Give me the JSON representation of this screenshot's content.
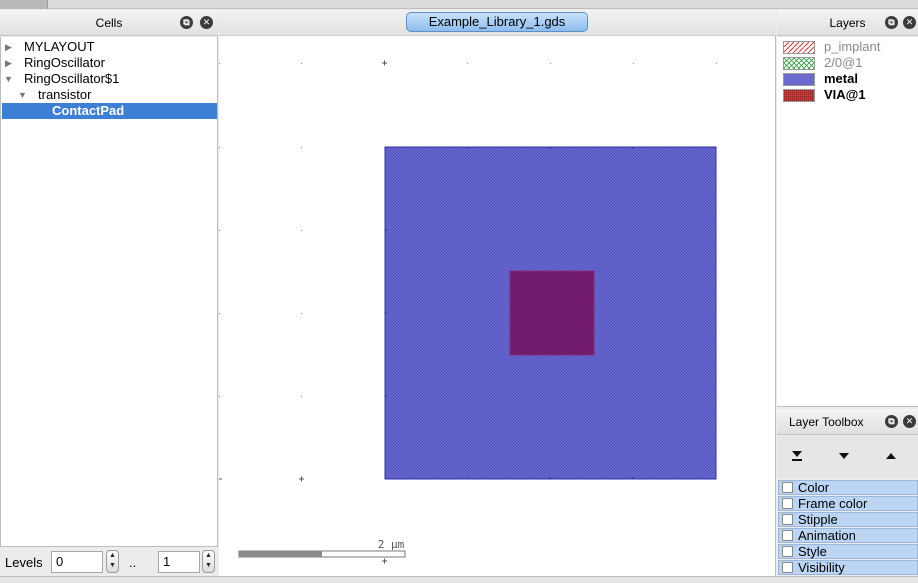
{
  "panels": {
    "cells_title": "Cells",
    "layers_title": "Layers",
    "toolbox_title": "Layer Toolbox"
  },
  "cells": {
    "items": [
      {
        "label": "MYLAYOUT",
        "indent": 0,
        "expanded": false
      },
      {
        "label": "RingOscillator",
        "indent": 0,
        "expanded": false
      },
      {
        "label": "RingOscillator$1",
        "indent": 0,
        "expanded": true
      },
      {
        "label": "transistor",
        "indent": 1,
        "expanded": true
      },
      {
        "label": "ContactPad",
        "indent": 2,
        "selected": true
      }
    ],
    "levels_label": "Levels",
    "level_from": "0",
    "level_separator": "..",
    "level_to": "1"
  },
  "document": {
    "tab_label": "Example_Library_1.gds"
  },
  "canvas": {
    "scale_label": "2 µm",
    "metal_color": "#6a6acf",
    "via_color": "#7a1f73"
  },
  "layers": {
    "items": [
      {
        "name": "p_implant",
        "style": "dim",
        "swatch": "hatch-red"
      },
      {
        "name": "2/0@1",
        "style": "dim",
        "swatch": "crosshatch-green"
      },
      {
        "name": "metal",
        "style": "bold",
        "swatch": "solid-blue"
      },
      {
        "name": "VIA@1",
        "style": "bold",
        "swatch": "dots-red"
      }
    ]
  },
  "toolbox": {
    "buttons": [
      {
        "icon": "move-to-bottom-icon"
      },
      {
        "icon": "move-down-icon"
      },
      {
        "icon": "move-up-icon"
      }
    ],
    "items": [
      "Color",
      "Frame color",
      "Stipple",
      "Animation",
      "Style",
      "Visibility"
    ]
  }
}
